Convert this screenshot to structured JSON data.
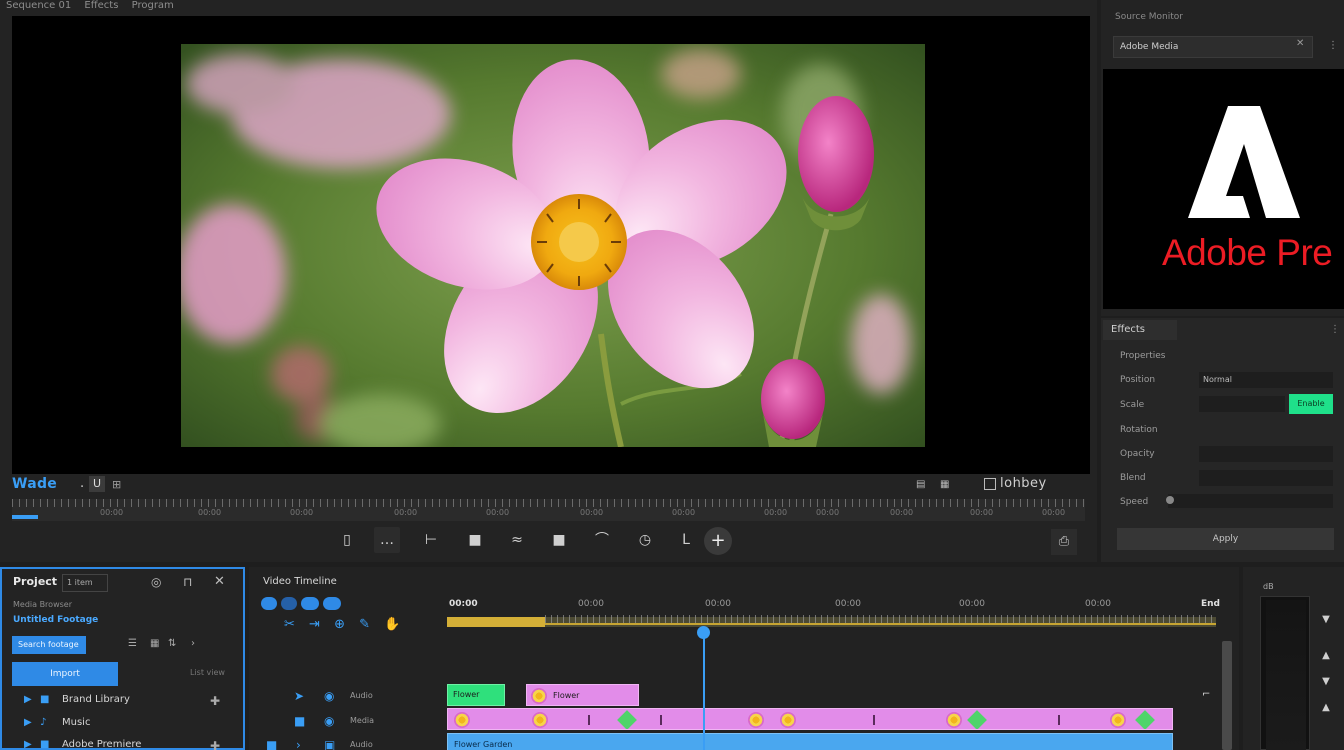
{
  "monitor": {
    "tabs": [
      "Sequence 01",
      "Effects",
      "Program"
    ],
    "title": "Wade",
    "dot": ".",
    "seq_btn": "U",
    "quality_label": "lohbey",
    "ruler_labels": [
      "00:00",
      "00:00",
      "00:00",
      "00:00",
      "00:00",
      "00:00",
      "00:00",
      "00:00",
      "00:00",
      "00:00",
      "00:00",
      "00:00"
    ],
    "controls": [
      "▯",
      "…",
      "⊢",
      "■",
      "≈",
      "■",
      "⌒",
      "◷",
      "L",
      "+"
    ],
    "export_icon": "⎙"
  },
  "source": {
    "tab_label": "Source Monitor",
    "select_value": "Adobe Media",
    "logo_text": "Adobe Pre",
    "brand_color": "#ec1c24"
  },
  "effects": {
    "tab_label": "Effects",
    "labels": [
      "Properties",
      "Position",
      "Scale",
      "Rotation",
      "Opacity",
      "Blend",
      "Speed"
    ],
    "fields": [
      "Normal",
      "",
      "",
      "",
      ""
    ],
    "toggle_label": "Enable",
    "apply_label": "Apply",
    "accent_color": "#1fe08a"
  },
  "project": {
    "title": "Project",
    "count": "1 item",
    "subtitle": "Media Browser",
    "bin_label": "Untitled Footage",
    "search_value": "Search footage",
    "new_btn": "Import",
    "new_side": "List view",
    "rows": [
      {
        "label": "Brand Library",
        "icon": "▶"
      },
      {
        "label": "Music",
        "icon": "▶"
      },
      {
        "label": "Adobe Premiere",
        "icon": "▶"
      }
    ],
    "accent_color": "#2f8ae6"
  },
  "timeline": {
    "title": "Video Timeline",
    "times": [
      "00:00",
      "00:00",
      "00:00",
      "00:00",
      "00:00",
      "00:00"
    ],
    "end_label": "End",
    "tracks": [
      {
        "name": "Audio"
      },
      {
        "name": "Media"
      },
      {
        "name": "Audio"
      }
    ],
    "clip_labels": [
      "Flower",
      "Flower",
      "Flower Garden"
    ]
  },
  "meters": {
    "label": "dB",
    "knobs": [
      "▼",
      "▲",
      "▼",
      "▲"
    ]
  }
}
